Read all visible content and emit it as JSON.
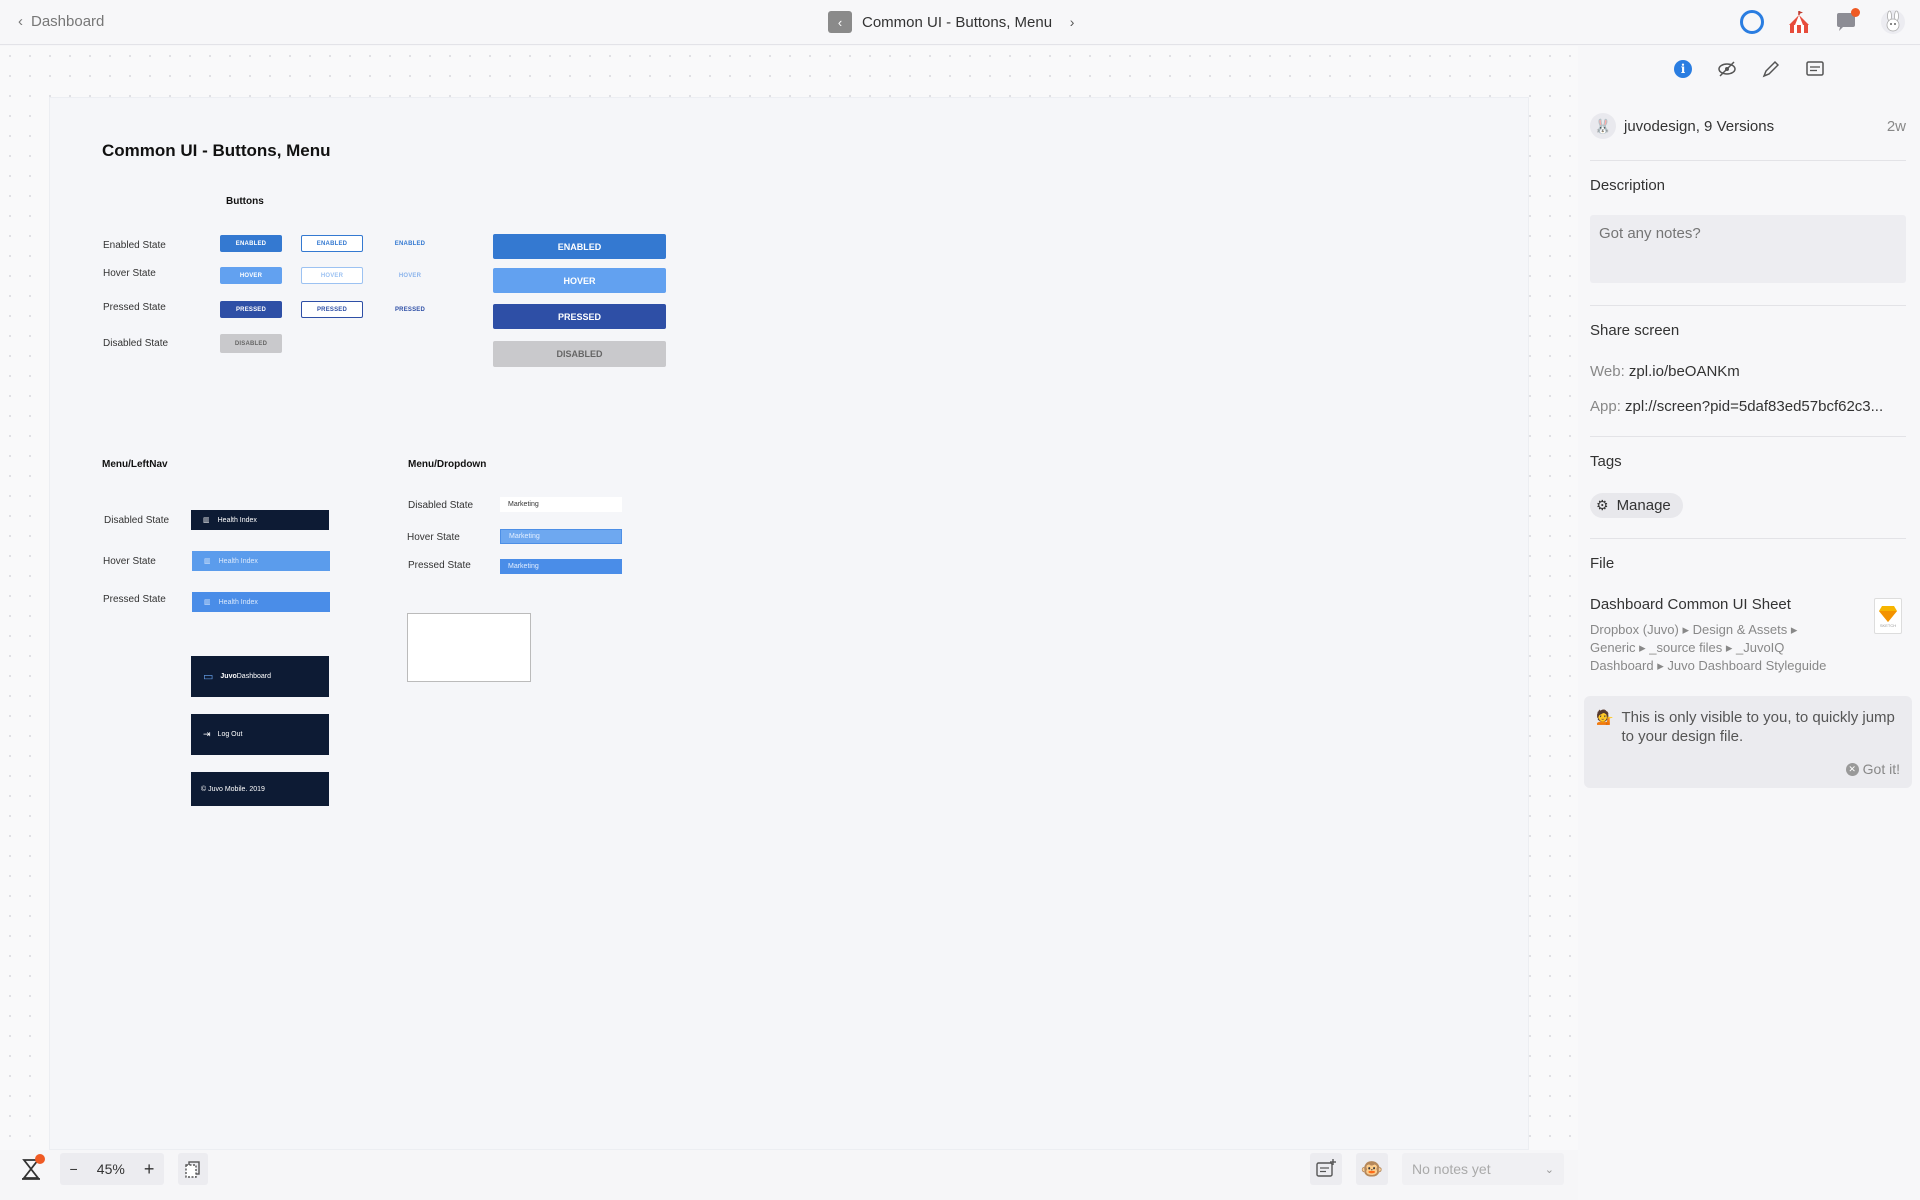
{
  "topbar": {
    "back_label": "Dashboard",
    "screen_title": "Common UI - Buttons, Menu"
  },
  "artboard": {
    "title": "Common UI - Buttons, Menu",
    "buttons_section": "Buttons",
    "states": [
      "Enabled State",
      "Hover State",
      "Pressed State",
      "Disabled State"
    ],
    "small_buttons": {
      "enabled": "ENABLED",
      "hover": "HOVER",
      "pressed": "PRESSED",
      "disabled": "DISABLED"
    },
    "large_buttons": {
      "enabled": "ENABLED",
      "hover": "HOVER",
      "pressed": "PRESSED",
      "disabled": "DISABLED"
    },
    "leftnav_section": "Menu/LeftNav",
    "leftnav_states": [
      "Disabled State",
      "Hover State",
      "Pressed State"
    ],
    "leftnav_item": "Health Index",
    "brand_bold": "Juvo",
    "brand_rest": "Dashboard",
    "logout": "Log Out",
    "copyright": "© Juvo Mobile. 2019",
    "dropdown_section": "Menu/Dropdown",
    "dropdown_states": [
      "Disabled State",
      "Hover State",
      "Pressed State"
    ],
    "dropdown_item": "Marketing"
  },
  "sidebar": {
    "author": "juvodesign, 9 Versions",
    "age": "2w",
    "description_head": "Description",
    "notes_placeholder": "Got any notes?",
    "share_head": "Share screen",
    "web_label": "Web:",
    "web_value": "zpl.io/beOANKm",
    "app_label": "App:",
    "app_value": "zpl://screen?pid=5daf83ed57bcf62c3...",
    "tags_head": "Tags",
    "manage_label": "Manage",
    "file_head": "File",
    "file_name": "Dashboard Common UI Sheet",
    "file_path_1": "Dropbox (Juvo) ▸ Design & Assets ▸",
    "file_path_2": "Generic ▸ _source files ▸ _JuvoIQ",
    "file_path_3": "Dashboard ▸ Juvo Dashboard Styleguide",
    "sketch_label": "SKETCH",
    "tip_text": "This is only visible to you, to quickly jump to your design file.",
    "got_it": "Got it!"
  },
  "bottombar": {
    "zoom_minus": "−",
    "zoom_value": "45%",
    "zoom_plus": "+",
    "notes_select": "No notes yet"
  },
  "colors": {
    "accent": "#2a7de1",
    "enabled": "#3479d1",
    "hover": "#62a1f0",
    "pressed": "#2e4fa6",
    "disabled": "#c9c9cc",
    "nav_dark": "#0d1b34",
    "notification": "#ef5a24"
  }
}
